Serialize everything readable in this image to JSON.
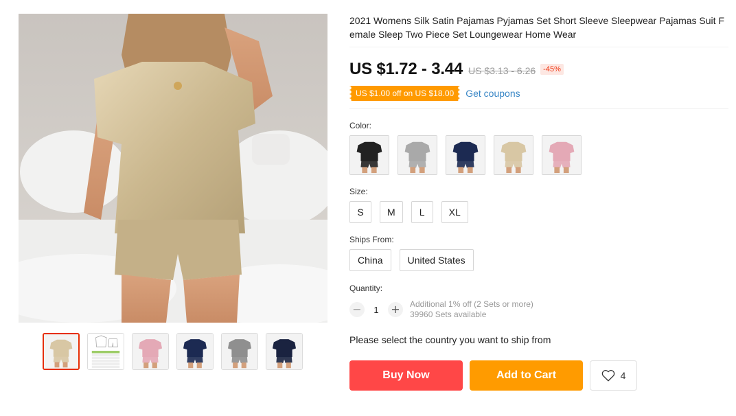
{
  "product": {
    "title": "2021 Womens Silk Satin Pajamas Pyjamas Set Short Sleeve Sleepwear Pajamas Suit Female Sleep Two Piece Set Loungewear Home Wear",
    "price": "US $1.72 - 3.44",
    "original_price": "US $3.13 - 6.26",
    "discount": "-45%"
  },
  "coupon": {
    "label": "US $1.00 off on US $18.00",
    "link": "Get coupons"
  },
  "color": {
    "label": "Color:",
    "options": [
      {
        "name": "black",
        "hex": "#222222"
      },
      {
        "name": "gray",
        "hex": "#a9a9a9"
      },
      {
        "name": "navy",
        "hex": "#1c2a52"
      },
      {
        "name": "champagne",
        "hex": "#d8c7a4"
      },
      {
        "name": "pink",
        "hex": "#e4a9b6"
      }
    ]
  },
  "size": {
    "label": "Size:",
    "options": [
      "S",
      "M",
      "L",
      "XL"
    ]
  },
  "ships_from": {
    "label": "Ships From:",
    "options": [
      "China",
      "United States"
    ]
  },
  "quantity": {
    "label": "Quantity:",
    "minus": "−",
    "plus": "+",
    "value": "1",
    "note_discount": "Additional 1% off (2 Sets or more)",
    "note_available": "39960 Sets available"
  },
  "shipping_message": "Please select the country you want to ship from",
  "actions": {
    "buy_now": "Buy Now",
    "add_to_cart": "Add to Cart",
    "wishlist_count": "4"
  },
  "thumbnails": [
    {
      "name": "champagne-set",
      "hex": "#d8c7a4",
      "active": true
    },
    {
      "name": "size-chart",
      "hex": "#f4f4f4",
      "active": false
    },
    {
      "name": "pink-set",
      "hex": "#e4a9b6",
      "active": false
    },
    {
      "name": "navy-set",
      "hex": "#1c2a52",
      "active": false
    },
    {
      "name": "gray-set",
      "hex": "#8f8f8f",
      "active": false
    },
    {
      "name": "black-set",
      "hex": "#1a2340",
      "active": false
    }
  ],
  "colors": {
    "price": "#111111",
    "buy_now": "#ff4747",
    "add_to_cart": "#ff9b00",
    "coupon_bg": "#ff9a00",
    "link": "#3a87c6",
    "discount": "#f03a17"
  },
  "icons": {
    "wishlist": "heart-outline-icon"
  }
}
